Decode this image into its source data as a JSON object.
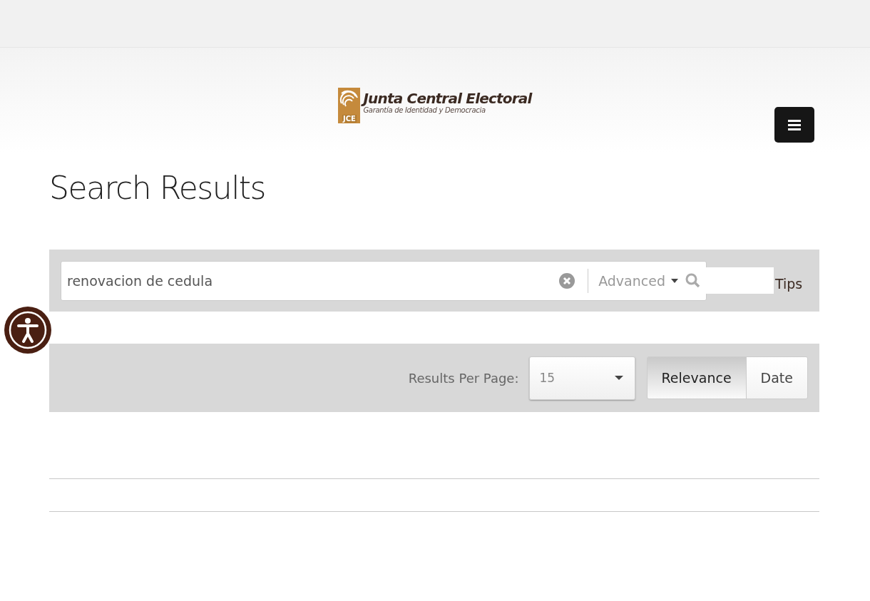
{
  "logo": {
    "mark_text": "JCE",
    "title": "Junta Central Electoral",
    "subtitle": "Garantía de Identidad y Democracia"
  },
  "page_title": "Search Results",
  "search": {
    "value": "renovacion de cedula",
    "advanced_label": "Advanced",
    "tips_label": "Tips"
  },
  "sort_bar": {
    "per_page_label": "Results Per Page:",
    "per_page_value": "15",
    "sort_options": [
      {
        "label": "Relevance",
        "selected": true
      },
      {
        "label": "Date",
        "selected": false
      }
    ]
  }
}
